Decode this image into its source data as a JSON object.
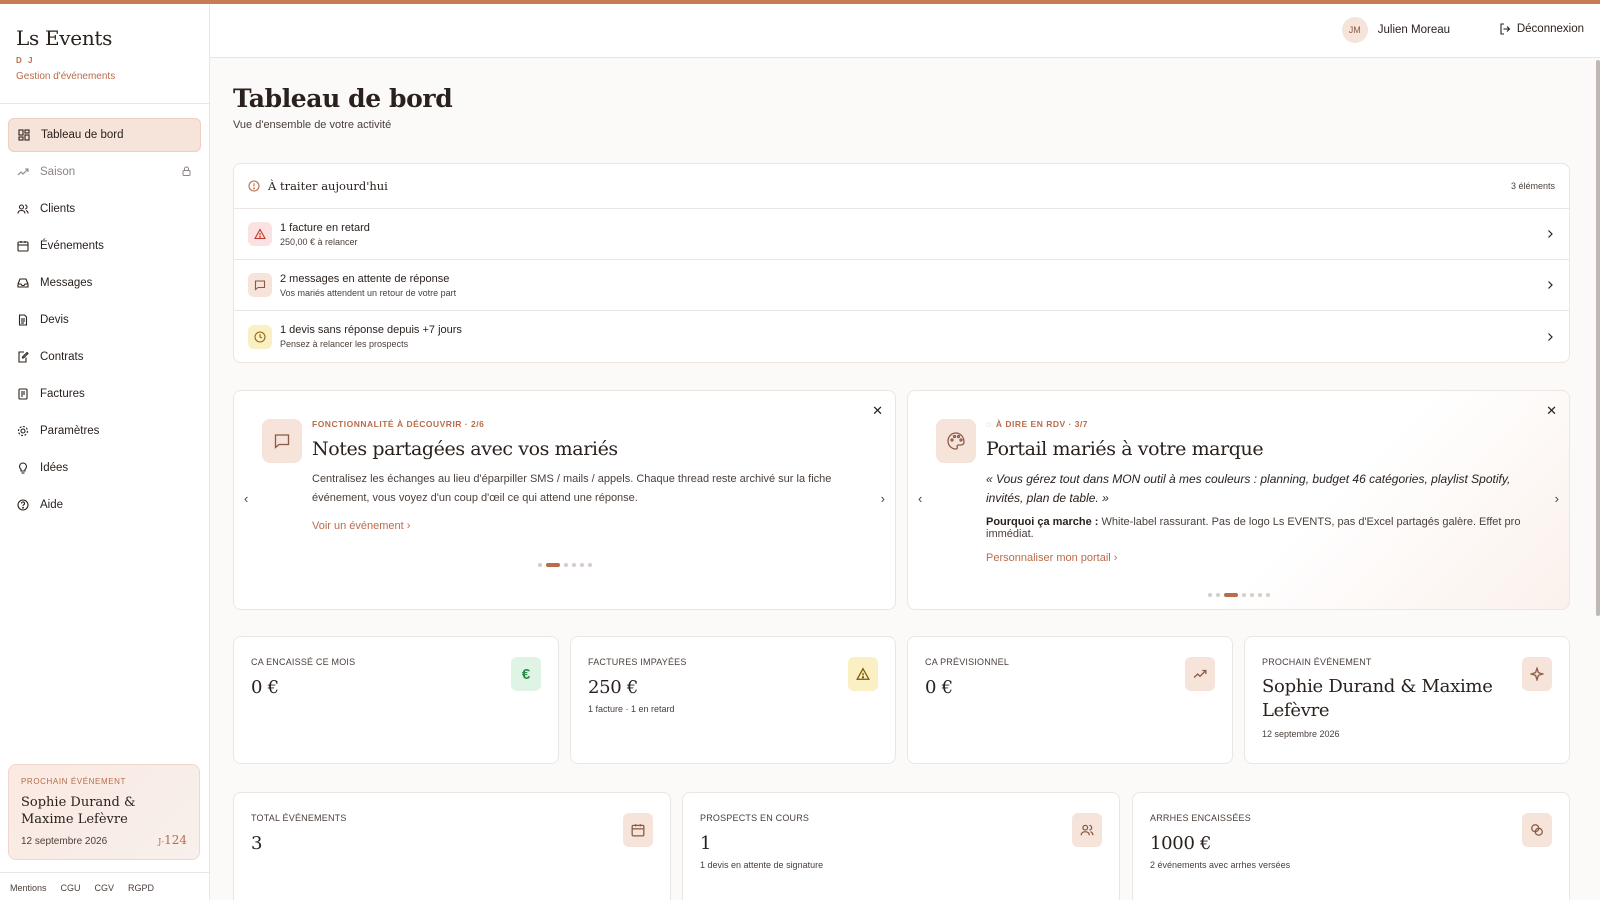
{
  "brand": {
    "name": "Ls Events",
    "sub": "D J",
    "tagline": "Gestion d'événements"
  },
  "nav": [
    {
      "label": "Tableau de bord",
      "icon": "dashboard-icon"
    },
    {
      "label": "Saison",
      "icon": "trend-icon"
    },
    {
      "label": "Clients",
      "icon": "users-icon"
    },
    {
      "label": "Événements",
      "icon": "calendar-icon"
    },
    {
      "label": "Messages",
      "icon": "inbox-icon"
    },
    {
      "label": "Devis",
      "icon": "document-icon"
    },
    {
      "label": "Contrats",
      "icon": "contract-icon"
    },
    {
      "label": "Factures",
      "icon": "invoice-icon"
    },
    {
      "label": "Paramètres",
      "icon": "gear-icon"
    },
    {
      "label": "Idées",
      "icon": "lightbulb-icon"
    },
    {
      "label": "Aide",
      "icon": "help-icon"
    }
  ],
  "sidebar_next": {
    "label": "PROCHAIN ÉVÉNEMENT",
    "name": "Sophie Durand & Maxime Lefèvre",
    "date": "12 septembre 2026",
    "countdown_prefix": "J-",
    "countdown": "124"
  },
  "footer_links": [
    "Mentions",
    "CGU",
    "CGV",
    "RGPD"
  ],
  "user": {
    "initials": "JM",
    "name": "Julien Moreau",
    "logout": "Déconnexion"
  },
  "page": {
    "title": "Tableau de bord",
    "subtitle": "Vue d'ensemble de votre activité"
  },
  "todo": {
    "title": "À traiter aujourd'hui",
    "count": "3 éléments",
    "items": [
      {
        "title": "1 facture en retard",
        "sub": "250,00 € à relancer"
      },
      {
        "title": "2 messages en attente de réponse",
        "sub": "Vos mariés attendent un retour de votre part"
      },
      {
        "title": "1 devis sans réponse depuis +7 jours",
        "sub": "Pensez à relancer les prospects"
      }
    ]
  },
  "promo_left": {
    "kicker": "FONCTIONNALITÉ À DÉCOUVRIR · 2/6",
    "title": "Notes partagées avec vos mariés",
    "text": "Centralisez les échanges au lieu d'éparpiller SMS / mails / appels. Chaque thread reste archivé sur la fiche événement, vous voyez d'un coup d'œil ce qui attend une réponse.",
    "link": "Voir un événement",
    "active_dot": 1
  },
  "promo_right": {
    "kicker": "À DIRE EN RDV · 3/7",
    "title": "Portail mariés à votre marque",
    "quote": "« Vous gérez tout dans MON outil à mes couleurs : planning, budget 46 catégories, playlist Spotify, invités, plan de table. »",
    "why_label": "Pourquoi ça marche :",
    "why_text": "White-label rassurant. Pas de logo Ls EVENTS, pas d'Excel partagés galère. Effet pro immédiat.",
    "link": "Personnaliser mon portail",
    "active_dot": 2
  },
  "kpis_row1": [
    {
      "label": "CA ENCAISSÉ CE MOIS",
      "value": "0 €",
      "sub": "",
      "icon": "euro-icon"
    },
    {
      "label": "FACTURES IMPAYÉES",
      "value": "250 €",
      "sub": "1 facture · 1 en retard",
      "icon": "alert-icon"
    },
    {
      "label": "CA PRÉVISIONNEL",
      "value": "0 €",
      "sub": "",
      "icon": "trend-icon"
    },
    {
      "label": "PROCHAIN ÉVÉNEMENT",
      "value": "Sophie Durand & Maxime Lefèvre",
      "sub": "12 septembre 2026",
      "icon": "sparkle-icon"
    }
  ],
  "kpis_row2": [
    {
      "label": "TOTAL ÉVÉNEMENTS",
      "value": "3",
      "sub": "",
      "icon": "calendar-icon"
    },
    {
      "label": "PROSPECTS EN COURS",
      "value": "1",
      "sub": "1 devis en attente de signature",
      "icon": "users-icon"
    },
    {
      "label": "ARRHES ENCAISSÉES",
      "value": "1000 €",
      "sub": "2 événements avec arrhes versées",
      "icon": "coins-icon"
    }
  ],
  "colors": {
    "accent": "#b86c4a",
    "accent_soft": "#f6e3da",
    "topline": "#c87a57"
  }
}
